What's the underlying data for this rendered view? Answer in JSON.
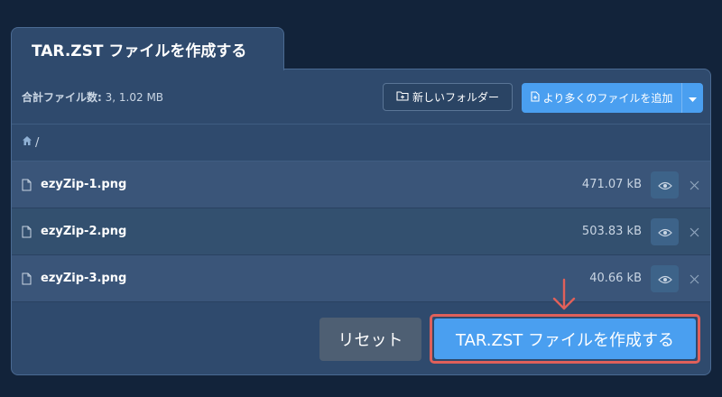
{
  "tab": {
    "title": "TAR.ZST ファイルを作成する"
  },
  "toolbar": {
    "summary_label": "合計ファイル数:",
    "summary_value": "3, 1.02 MB",
    "new_folder_label": "新しいフォルダー",
    "add_files_label": "より多くのファイルを追加"
  },
  "breadcrumb": {
    "path": "/"
  },
  "files": [
    {
      "name": "ezyZip-1.png",
      "size": "471.07 kB"
    },
    {
      "name": "ezyZip-2.png",
      "size": "503.83 kB"
    },
    {
      "name": "ezyZip-3.png",
      "size": "40.66 kB"
    }
  ],
  "footer": {
    "reset_label": "リセット",
    "create_label": "TAR.ZST ファイルを作成する"
  },
  "colors": {
    "background": "#12233a",
    "panel": "#2f4a6d",
    "accent": "#4a9ff0",
    "highlight": "#e0605a"
  },
  "icons": [
    "folder-plus-icon",
    "file-plus-icon",
    "caret-down-icon",
    "home-icon",
    "file-icon",
    "eye-icon",
    "close-icon",
    "arrow-down-icon"
  ]
}
